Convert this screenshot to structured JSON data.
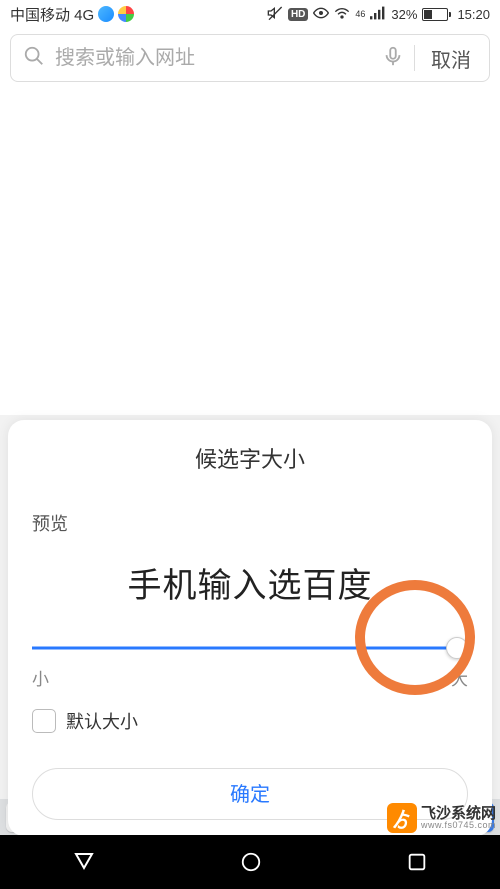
{
  "status": {
    "carrier": "中国移动 4G",
    "network_gen": "4G",
    "hd": "HD",
    "signal_sub": "46",
    "battery_pct": "32%",
    "time": "15:20"
  },
  "search": {
    "placeholder": "搜索或输入网址",
    "cancel": "取消"
  },
  "sheet": {
    "title": "候选字大小",
    "preview_label": "预览",
    "preview_text": "手机输入选百度",
    "slider_min_label": "小",
    "slider_max_label": "大",
    "default_checkbox_label": "默认大小",
    "confirm": "确定"
  },
  "watermark": {
    "badge": "ゟ",
    "main": "飞沙系统网",
    "sub": "www.fs0745.com"
  }
}
